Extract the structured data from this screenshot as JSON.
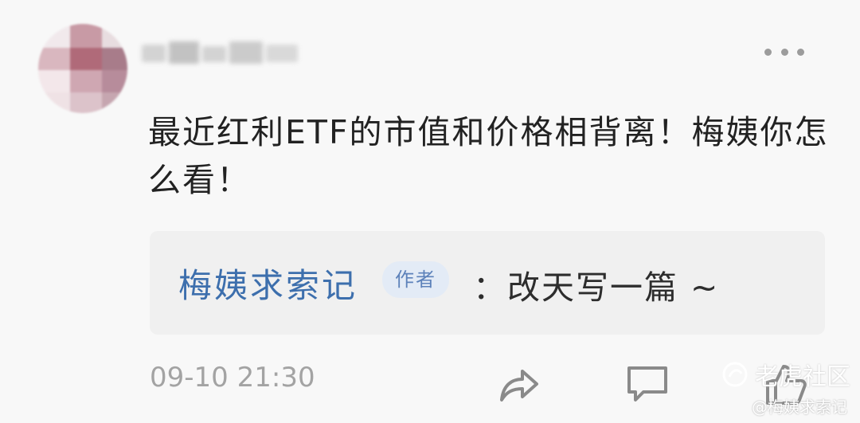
{
  "comment": {
    "text": "最近红利ETF的市值和价格相背离！梅姨你怎么看！"
  },
  "reply": {
    "author": "梅姨求索记",
    "badge": "作者",
    "text": "：改天写一篇 ~"
  },
  "footer": {
    "timestamp": "09-10 21:30"
  },
  "icons": [
    "more-icon",
    "share-icon",
    "comment-icon",
    "like-icon"
  ],
  "watermark": {
    "site": "老虎社区",
    "handle": "@梅姨求索记"
  },
  "colors": {
    "author_link": "#3d6fad",
    "badge_bg": "#e3ebf6",
    "reply_bg": "#f0f0f0",
    "timestamp": "#a3a3a3"
  }
}
